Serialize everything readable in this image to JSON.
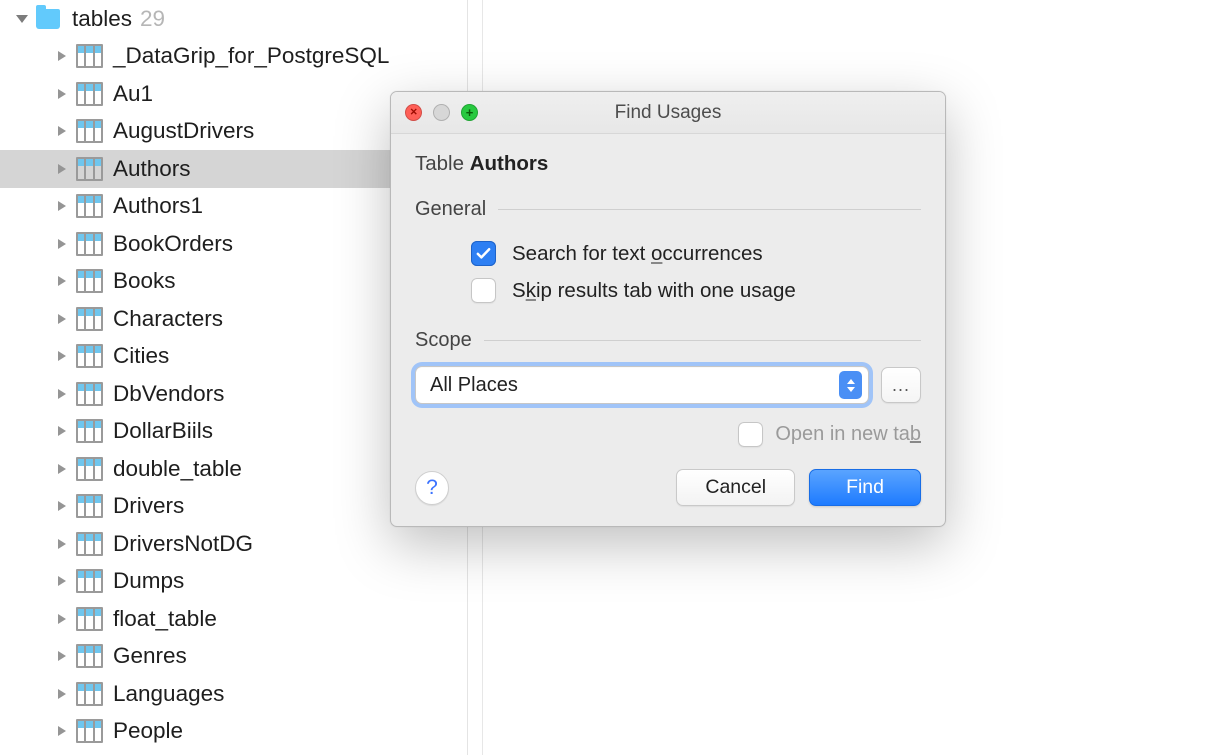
{
  "tree": {
    "folder_label": "tables",
    "folder_count": "29",
    "items": [
      {
        "label": "_DataGrip_for_PostgreSQL",
        "selected": false
      },
      {
        "label": "Au1",
        "selected": false
      },
      {
        "label": "AugustDrivers",
        "selected": false
      },
      {
        "label": "Authors",
        "selected": true
      },
      {
        "label": "Authors1",
        "selected": false
      },
      {
        "label": "BookOrders",
        "selected": false
      },
      {
        "label": "Books",
        "selected": false
      },
      {
        "label": "Characters",
        "selected": false
      },
      {
        "label": "Cities",
        "selected": false
      },
      {
        "label": "DbVendors",
        "selected": false
      },
      {
        "label": "DollarBiils",
        "selected": false
      },
      {
        "label": "double_table",
        "selected": false
      },
      {
        "label": "Drivers",
        "selected": false
      },
      {
        "label": "DriversNotDG",
        "selected": false
      },
      {
        "label": "Dumps",
        "selected": false
      },
      {
        "label": "float_table",
        "selected": false
      },
      {
        "label": "Genres",
        "selected": false
      },
      {
        "label": "Languages",
        "selected": false
      },
      {
        "label": "People",
        "selected": false
      }
    ]
  },
  "dialog": {
    "title": "Find Usages",
    "subject_prefix": "Table ",
    "subject_name": "Authors",
    "general_label": "General",
    "opt_search": {
      "pre": "Search for text ",
      "u": "o",
      "post": "ccurrences",
      "checked": true
    },
    "opt_skip": {
      "pre": "S",
      "u": "k",
      "post": "ip results tab with one usage",
      "checked": false
    },
    "scope_label": "Scope",
    "scope_value": "All Places",
    "more_btn": "...",
    "open_tab": {
      "pre": "Open in new ta",
      "u": "b",
      "post": "",
      "checked": false
    },
    "help": "?",
    "cancel": "Cancel",
    "find": "Find"
  }
}
